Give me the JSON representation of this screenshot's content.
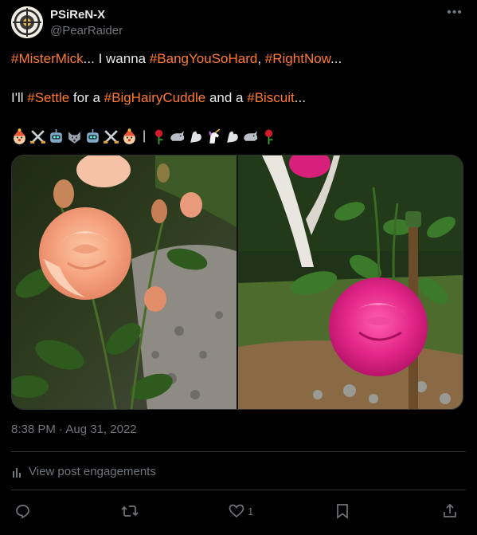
{
  "author": {
    "name": "PSiReN-X",
    "handle": "@PearRaider"
  },
  "post": {
    "line1": [
      {
        "t": "#MisterMick",
        "tag": true
      },
      {
        "t": "... I wanna ",
        "tag": false
      },
      {
        "t": "#BangYouSoHard",
        "tag": true
      },
      {
        "t": ", ",
        "tag": false
      },
      {
        "t": "#RightNow",
        "tag": true
      },
      {
        "t": "...",
        "tag": false
      }
    ],
    "line2": [
      {
        "t": "I'll ",
        "tag": false
      },
      {
        "t": "#Settle",
        "tag": true
      },
      {
        "t": " for a ",
        "tag": false
      },
      {
        "t": "#BigHairyCuddle",
        "tag": true
      },
      {
        "t": " and a ",
        "tag": false
      },
      {
        "t": "#Biscuit",
        "tag": true
      },
      {
        "t": "...",
        "tag": false
      }
    ],
    "emoji_separator": "|",
    "timestamp": "8:38 PM · Aug 31, 2022",
    "view_engagements": "View post engagements",
    "like_count": "1"
  },
  "colors": {
    "hashtag": "#ff7a30",
    "muted": "#71767b",
    "text": "#e7e9ea",
    "border": "#2f3336"
  },
  "icons": [
    "more-icon",
    "bar-chart-icon",
    "reply-icon",
    "repost-icon",
    "like-icon",
    "bookmark-icon",
    "share-icon"
  ]
}
